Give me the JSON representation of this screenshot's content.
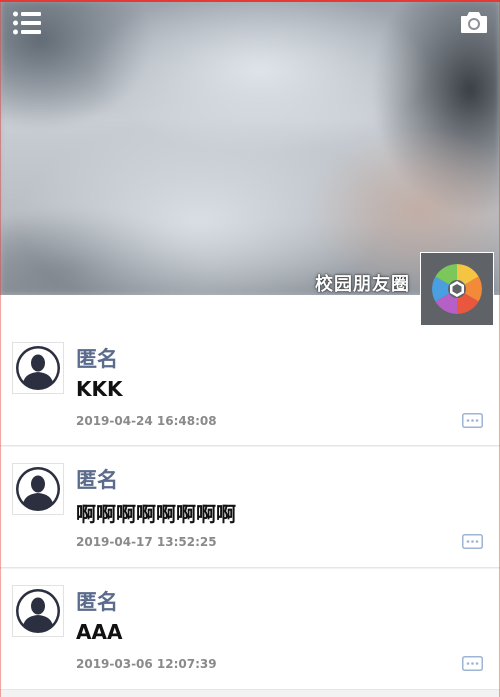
{
  "header": {
    "title": "校园朋友圈",
    "menu_icon": "list-menu-icon",
    "camera_icon": "camera-icon",
    "app_logo_icon": "aperture-logo-icon"
  },
  "colors": {
    "accent": "#e53935",
    "name": "#5a6b8c",
    "more_icon": "#9db4d3"
  },
  "posts": [
    {
      "name": "匿名",
      "content": "KKK",
      "time": "2019-04-24 16:48:08"
    },
    {
      "name": "匿名",
      "content": "啊啊啊啊啊啊啊啊",
      "time": "2019-04-17 13:52:25"
    },
    {
      "name": "匿名",
      "content": "AAA",
      "time": "2019-03-06 12:07:39"
    }
  ]
}
